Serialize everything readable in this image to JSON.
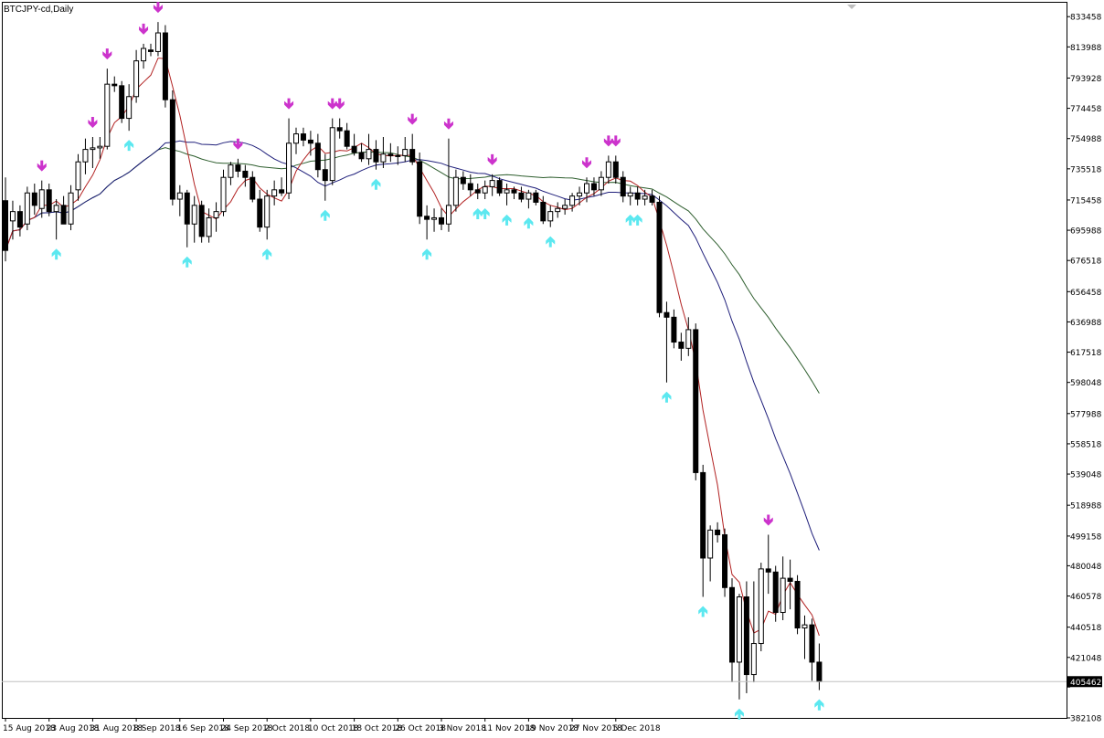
{
  "chart_title": "BTCJPY-cd,Daily",
  "chart_data": {
    "type": "candlestick",
    "symbol": "BTCJPY-cd",
    "timeframe": "Daily",
    "price_ticks": [
      "833458",
      "813988",
      "793928",
      "774458",
      "754988",
      "735518",
      "715458",
      "695988",
      "676518",
      "656458",
      "636988",
      "617518",
      "598048",
      "577988",
      "558518",
      "539048",
      "518988",
      "499158",
      "480048",
      "460578",
      "440518",
      "421048",
      "401978",
      "382108"
    ],
    "date_ticks": [
      "15 Aug 2018",
      "23 Aug 2018",
      "31 Aug 2018",
      "8 Sep 2018",
      "16 Sep 2018",
      "24 Sep 2018",
      "2 Oct 2018",
      "10 Oct 2018",
      "18 Oct 2018",
      "26 Oct 2018",
      "3 Nov 2018",
      "11 Nov 2018",
      "19 Nov 2018",
      "27 Nov 2018",
      "5 Dec 2018"
    ],
    "y_range": [
      382108,
      843000
    ],
    "current_price": "405462",
    "colors": {
      "bull_body": "#ffffff",
      "bear_body": "#000000",
      "ma_fast": "#b22222",
      "ma_mid": "#1e1e7a",
      "ma_slow": "#2e5e2e",
      "arrow_up": "#5ce8f0",
      "arrow_down": "#cc33cc"
    },
    "candles": [
      {
        "o": 715000,
        "h": 730000,
        "l": 676000,
        "c": 683000
      },
      {
        "o": 702000,
        "h": 715000,
        "l": 690000,
        "c": 708000
      },
      {
        "o": 708000,
        "h": 712000,
        "l": 692000,
        "c": 698000
      },
      {
        "o": 700000,
        "h": 724000,
        "l": 696000,
        "c": 720000
      },
      {
        "o": 720000,
        "h": 726000,
        "l": 706000,
        "c": 712000
      },
      {
        "o": 710000,
        "h": 728000,
        "l": 704000,
        "c": 722000
      },
      {
        "o": 722000,
        "h": 726000,
        "l": 705000,
        "c": 708000
      },
      {
        "o": 708000,
        "h": 716000,
        "l": 690000,
        "c": 712000
      },
      {
        "o": 712000,
        "h": 718000,
        "l": 700000,
        "c": 700000
      },
      {
        "o": 700000,
        "h": 725000,
        "l": 696000,
        "c": 720000
      },
      {
        "o": 722000,
        "h": 745000,
        "l": 715000,
        "c": 740000
      },
      {
        "o": 740000,
        "h": 755000,
        "l": 732000,
        "c": 748000
      },
      {
        "o": 748000,
        "h": 756000,
        "l": 736000,
        "c": 749000
      },
      {
        "o": 749000,
        "h": 756000,
        "l": 742000,
        "c": 750000
      },
      {
        "o": 750000,
        "h": 800000,
        "l": 748000,
        "c": 790000
      },
      {
        "o": 790000,
        "h": 795000,
        "l": 785000,
        "c": 789000
      },
      {
        "o": 789000,
        "h": 792000,
        "l": 765000,
        "c": 768000
      },
      {
        "o": 768000,
        "h": 790000,
        "l": 760000,
        "c": 782000
      },
      {
        "o": 782000,
        "h": 812000,
        "l": 778000,
        "c": 805000
      },
      {
        "o": 805000,
        "h": 816000,
        "l": 800000,
        "c": 813000
      },
      {
        "o": 812000,
        "h": 816000,
        "l": 808000,
        "c": 811000
      },
      {
        "o": 811000,
        "h": 830000,
        "l": 808000,
        "c": 823000
      },
      {
        "o": 823000,
        "h": 828000,
        "l": 775000,
        "c": 780000
      },
      {
        "o": 780000,
        "h": 786000,
        "l": 712000,
        "c": 716000
      },
      {
        "o": 716000,
        "h": 725000,
        "l": 705000,
        "c": 720000
      },
      {
        "o": 720000,
        "h": 722000,
        "l": 685000,
        "c": 700000
      },
      {
        "o": 700000,
        "h": 718000,
        "l": 688000,
        "c": 712000
      },
      {
        "o": 712000,
        "h": 715000,
        "l": 688000,
        "c": 692000
      },
      {
        "o": 692000,
        "h": 710000,
        "l": 688000,
        "c": 704000
      },
      {
        "o": 704000,
        "h": 714000,
        "l": 695000,
        "c": 708000
      },
      {
        "o": 708000,
        "h": 735000,
        "l": 705000,
        "c": 730000
      },
      {
        "o": 730000,
        "h": 740000,
        "l": 725000,
        "c": 738000
      },
      {
        "o": 738000,
        "h": 742000,
        "l": 730000,
        "c": 734000
      },
      {
        "o": 734000,
        "h": 738000,
        "l": 724000,
        "c": 730000
      },
      {
        "o": 730000,
        "h": 734000,
        "l": 714000,
        "c": 716000
      },
      {
        "o": 716000,
        "h": 722000,
        "l": 695000,
        "c": 698000
      },
      {
        "o": 698000,
        "h": 722000,
        "l": 690000,
        "c": 718000
      },
      {
        "o": 718000,
        "h": 728000,
        "l": 712000,
        "c": 722000
      },
      {
        "o": 722000,
        "h": 730000,
        "l": 718000,
        "c": 720000
      },
      {
        "o": 720000,
        "h": 768000,
        "l": 716000,
        "c": 752000
      },
      {
        "o": 752000,
        "h": 762000,
        "l": 745000,
        "c": 758000
      },
      {
        "o": 758000,
        "h": 762000,
        "l": 750000,
        "c": 754000
      },
      {
        "o": 754000,
        "h": 760000,
        "l": 744000,
        "c": 752000
      },
      {
        "o": 752000,
        "h": 758000,
        "l": 730000,
        "c": 735000
      },
      {
        "o": 735000,
        "h": 745000,
        "l": 715000,
        "c": 728000
      },
      {
        "o": 728000,
        "h": 768000,
        "l": 725000,
        "c": 762000
      },
      {
        "o": 762000,
        "h": 768000,
        "l": 755000,
        "c": 760000
      },
      {
        "o": 760000,
        "h": 765000,
        "l": 748000,
        "c": 750000
      },
      {
        "o": 750000,
        "h": 758000,
        "l": 744000,
        "c": 746000
      },
      {
        "o": 746000,
        "h": 752000,
        "l": 740000,
        "c": 742000
      },
      {
        "o": 742000,
        "h": 758000,
        "l": 738000,
        "c": 748000
      },
      {
        "o": 748000,
        "h": 754000,
        "l": 735000,
        "c": 740000
      },
      {
        "o": 740000,
        "h": 756000,
        "l": 736000,
        "c": 745000
      },
      {
        "o": 745000,
        "h": 752000,
        "l": 740000,
        "c": 744000
      },
      {
        "o": 744000,
        "h": 750000,
        "l": 738000,
        "c": 744000
      },
      {
        "o": 744000,
        "h": 756000,
        "l": 740000,
        "c": 748000
      },
      {
        "o": 748000,
        "h": 758000,
        "l": 738000,
        "c": 740000
      },
      {
        "o": 740000,
        "h": 746000,
        "l": 700000,
        "c": 705000
      },
      {
        "o": 705000,
        "h": 712000,
        "l": 690000,
        "c": 703000
      },
      {
        "o": 703000,
        "h": 710000,
        "l": 695000,
        "c": 704000
      },
      {
        "o": 704000,
        "h": 710000,
        "l": 696000,
        "c": 700000
      },
      {
        "o": 700000,
        "h": 755000,
        "l": 695000,
        "c": 712000
      },
      {
        "o": 712000,
        "h": 735000,
        "l": 708000,
        "c": 730000
      },
      {
        "o": 730000,
        "h": 734000,
        "l": 722000,
        "c": 726000
      },
      {
        "o": 726000,
        "h": 732000,
        "l": 718000,
        "c": 722000
      },
      {
        "o": 722000,
        "h": 726000,
        "l": 716000,
        "c": 720000
      },
      {
        "o": 720000,
        "h": 728000,
        "l": 716000,
        "c": 724000
      },
      {
        "o": 724000,
        "h": 732000,
        "l": 718000,
        "c": 728000
      },
      {
        "o": 728000,
        "h": 730000,
        "l": 718000,
        "c": 720000
      },
      {
        "o": 720000,
        "h": 726000,
        "l": 712000,
        "c": 722000
      },
      {
        "o": 722000,
        "h": 724000,
        "l": 716000,
        "c": 720000
      },
      {
        "o": 720000,
        "h": 724000,
        "l": 714000,
        "c": 716000
      },
      {
        "o": 716000,
        "h": 722000,
        "l": 710000,
        "c": 720000
      },
      {
        "o": 720000,
        "h": 722000,
        "l": 712000,
        "c": 714000
      },
      {
        "o": 714000,
        "h": 718000,
        "l": 700000,
        "c": 702000
      },
      {
        "o": 702000,
        "h": 712000,
        "l": 698000,
        "c": 708000
      },
      {
        "o": 708000,
        "h": 714000,
        "l": 704000,
        "c": 710000
      },
      {
        "o": 710000,
        "h": 716000,
        "l": 706000,
        "c": 712000
      },
      {
        "o": 712000,
        "h": 720000,
        "l": 708000,
        "c": 718000
      },
      {
        "o": 718000,
        "h": 724000,
        "l": 712000,
        "c": 720000
      },
      {
        "o": 720000,
        "h": 730000,
        "l": 714000,
        "c": 726000
      },
      {
        "o": 726000,
        "h": 730000,
        "l": 718000,
        "c": 722000
      },
      {
        "o": 722000,
        "h": 734000,
        "l": 718000,
        "c": 730000
      },
      {
        "o": 730000,
        "h": 744000,
        "l": 726000,
        "c": 740000
      },
      {
        "o": 740000,
        "h": 744000,
        "l": 726000,
        "c": 730000
      },
      {
        "o": 730000,
        "h": 734000,
        "l": 714000,
        "c": 718000
      },
      {
        "o": 718000,
        "h": 724000,
        "l": 712000,
        "c": 720000
      },
      {
        "o": 720000,
        "h": 724000,
        "l": 712000,
        "c": 716000
      },
      {
        "o": 716000,
        "h": 722000,
        "l": 712000,
        "c": 718000
      },
      {
        "o": 718000,
        "h": 722000,
        "l": 712000,
        "c": 714000
      },
      {
        "o": 714000,
        "h": 718000,
        "l": 640000,
        "c": 643000
      },
      {
        "o": 643000,
        "h": 650000,
        "l": 598000,
        "c": 640000
      },
      {
        "o": 640000,
        "h": 645000,
        "l": 620000,
        "c": 624000
      },
      {
        "o": 624000,
        "h": 630000,
        "l": 612000,
        "c": 620000
      },
      {
        "o": 620000,
        "h": 640000,
        "l": 615000,
        "c": 632000
      },
      {
        "o": 632000,
        "h": 636000,
        "l": 535000,
        "c": 540000
      },
      {
        "o": 540000,
        "h": 545000,
        "l": 460000,
        "c": 485000
      },
      {
        "o": 485000,
        "h": 506000,
        "l": 470000,
        "c": 503000
      },
      {
        "o": 503000,
        "h": 508000,
        "l": 495000,
        "c": 500000
      },
      {
        "o": 500000,
        "h": 504000,
        "l": 460000,
        "c": 466000
      },
      {
        "o": 466000,
        "h": 472000,
        "l": 405000,
        "c": 418000
      },
      {
        "o": 418000,
        "h": 462000,
        "l": 394000,
        "c": 460000
      },
      {
        "o": 460000,
        "h": 470000,
        "l": 398000,
        "c": 410000
      },
      {
        "o": 410000,
        "h": 470000,
        "l": 405000,
        "c": 430000
      },
      {
        "o": 430000,
        "h": 482000,
        "l": 425000,
        "c": 478000
      },
      {
        "o": 478000,
        "h": 500000,
        "l": 462000,
        "c": 476000
      },
      {
        "o": 476000,
        "h": 480000,
        "l": 444000,
        "c": 450000
      },
      {
        "o": 450000,
        "h": 486000,
        "l": 445000,
        "c": 472000
      },
      {
        "o": 472000,
        "h": 484000,
        "l": 452000,
        "c": 470000
      },
      {
        "o": 470000,
        "h": 474000,
        "l": 436000,
        "c": 440000
      },
      {
        "o": 440000,
        "h": 448000,
        "l": 420000,
        "c": 442000
      },
      {
        "o": 442000,
        "h": 446000,
        "l": 406000,
        "c": 418000
      },
      {
        "o": 418000,
        "h": 430000,
        "l": 400000,
        "c": 405462
      }
    ]
  }
}
